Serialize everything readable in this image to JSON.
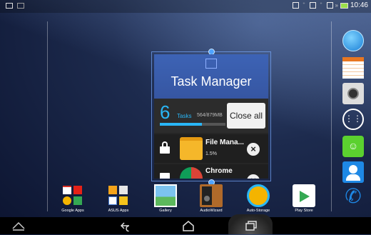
{
  "status_bar": {
    "time": "10:46"
  },
  "task_manager": {
    "title": "Task Manager",
    "task_count": "6",
    "tasks_label": "Tasks",
    "memory": "564/879MB",
    "memory_used_fraction": 0.64,
    "close_all_label": "Close all",
    "items": [
      {
        "name": "File Mana...",
        "size": "1.5%"
      },
      {
        "name": "Chrome",
        "size": ""
      }
    ]
  },
  "home_apps": [
    {
      "label": "Google Apps"
    },
    {
      "label": "ASUS Apps"
    },
    {
      "label": "Gallery"
    },
    {
      "label": "AudioWizard"
    },
    {
      "label": "Auto-Storage"
    },
    {
      "label": "Play Store"
    }
  ],
  "colors": {
    "accent": "#29b6f6",
    "header": "#3656a2"
  }
}
